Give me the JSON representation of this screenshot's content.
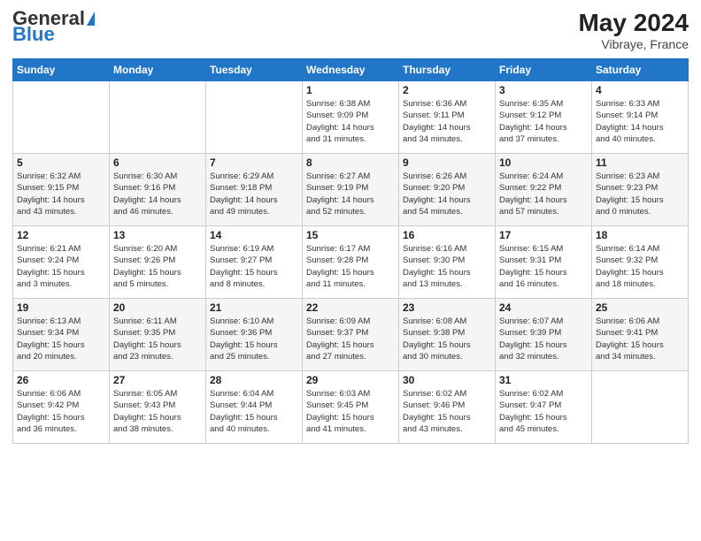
{
  "header": {
    "logo_text_general": "General",
    "logo_text_blue": "Blue",
    "month_year": "May 2024",
    "location": "Vibraye, France"
  },
  "days_of_week": [
    "Sunday",
    "Monday",
    "Tuesday",
    "Wednesday",
    "Thursday",
    "Friday",
    "Saturday"
  ],
  "weeks": [
    [
      {
        "num": "",
        "info": ""
      },
      {
        "num": "",
        "info": ""
      },
      {
        "num": "",
        "info": ""
      },
      {
        "num": "1",
        "info": "Sunrise: 6:38 AM\nSunset: 9:09 PM\nDaylight: 14 hours\nand 31 minutes."
      },
      {
        "num": "2",
        "info": "Sunrise: 6:36 AM\nSunset: 9:11 PM\nDaylight: 14 hours\nand 34 minutes."
      },
      {
        "num": "3",
        "info": "Sunrise: 6:35 AM\nSunset: 9:12 PM\nDaylight: 14 hours\nand 37 minutes."
      },
      {
        "num": "4",
        "info": "Sunrise: 6:33 AM\nSunset: 9:14 PM\nDaylight: 14 hours\nand 40 minutes."
      }
    ],
    [
      {
        "num": "5",
        "info": "Sunrise: 6:32 AM\nSunset: 9:15 PM\nDaylight: 14 hours\nand 43 minutes."
      },
      {
        "num": "6",
        "info": "Sunrise: 6:30 AM\nSunset: 9:16 PM\nDaylight: 14 hours\nand 46 minutes."
      },
      {
        "num": "7",
        "info": "Sunrise: 6:29 AM\nSunset: 9:18 PM\nDaylight: 14 hours\nand 49 minutes."
      },
      {
        "num": "8",
        "info": "Sunrise: 6:27 AM\nSunset: 9:19 PM\nDaylight: 14 hours\nand 52 minutes."
      },
      {
        "num": "9",
        "info": "Sunrise: 6:26 AM\nSunset: 9:20 PM\nDaylight: 14 hours\nand 54 minutes."
      },
      {
        "num": "10",
        "info": "Sunrise: 6:24 AM\nSunset: 9:22 PM\nDaylight: 14 hours\nand 57 minutes."
      },
      {
        "num": "11",
        "info": "Sunrise: 6:23 AM\nSunset: 9:23 PM\nDaylight: 15 hours\nand 0 minutes."
      }
    ],
    [
      {
        "num": "12",
        "info": "Sunrise: 6:21 AM\nSunset: 9:24 PM\nDaylight: 15 hours\nand 3 minutes."
      },
      {
        "num": "13",
        "info": "Sunrise: 6:20 AM\nSunset: 9:26 PM\nDaylight: 15 hours\nand 5 minutes."
      },
      {
        "num": "14",
        "info": "Sunrise: 6:19 AM\nSunset: 9:27 PM\nDaylight: 15 hours\nand 8 minutes."
      },
      {
        "num": "15",
        "info": "Sunrise: 6:17 AM\nSunset: 9:28 PM\nDaylight: 15 hours\nand 11 minutes."
      },
      {
        "num": "16",
        "info": "Sunrise: 6:16 AM\nSunset: 9:30 PM\nDaylight: 15 hours\nand 13 minutes."
      },
      {
        "num": "17",
        "info": "Sunrise: 6:15 AM\nSunset: 9:31 PM\nDaylight: 15 hours\nand 16 minutes."
      },
      {
        "num": "18",
        "info": "Sunrise: 6:14 AM\nSunset: 9:32 PM\nDaylight: 15 hours\nand 18 minutes."
      }
    ],
    [
      {
        "num": "19",
        "info": "Sunrise: 6:13 AM\nSunset: 9:34 PM\nDaylight: 15 hours\nand 20 minutes."
      },
      {
        "num": "20",
        "info": "Sunrise: 6:11 AM\nSunset: 9:35 PM\nDaylight: 15 hours\nand 23 minutes."
      },
      {
        "num": "21",
        "info": "Sunrise: 6:10 AM\nSunset: 9:36 PM\nDaylight: 15 hours\nand 25 minutes."
      },
      {
        "num": "22",
        "info": "Sunrise: 6:09 AM\nSunset: 9:37 PM\nDaylight: 15 hours\nand 27 minutes."
      },
      {
        "num": "23",
        "info": "Sunrise: 6:08 AM\nSunset: 9:38 PM\nDaylight: 15 hours\nand 30 minutes."
      },
      {
        "num": "24",
        "info": "Sunrise: 6:07 AM\nSunset: 9:39 PM\nDaylight: 15 hours\nand 32 minutes."
      },
      {
        "num": "25",
        "info": "Sunrise: 6:06 AM\nSunset: 9:41 PM\nDaylight: 15 hours\nand 34 minutes."
      }
    ],
    [
      {
        "num": "26",
        "info": "Sunrise: 6:06 AM\nSunset: 9:42 PM\nDaylight: 15 hours\nand 36 minutes."
      },
      {
        "num": "27",
        "info": "Sunrise: 6:05 AM\nSunset: 9:43 PM\nDaylight: 15 hours\nand 38 minutes."
      },
      {
        "num": "28",
        "info": "Sunrise: 6:04 AM\nSunset: 9:44 PM\nDaylight: 15 hours\nand 40 minutes."
      },
      {
        "num": "29",
        "info": "Sunrise: 6:03 AM\nSunset: 9:45 PM\nDaylight: 15 hours\nand 41 minutes."
      },
      {
        "num": "30",
        "info": "Sunrise: 6:02 AM\nSunset: 9:46 PM\nDaylight: 15 hours\nand 43 minutes."
      },
      {
        "num": "31",
        "info": "Sunrise: 6:02 AM\nSunset: 9:47 PM\nDaylight: 15 hours\nand 45 minutes."
      },
      {
        "num": "",
        "info": ""
      }
    ]
  ]
}
